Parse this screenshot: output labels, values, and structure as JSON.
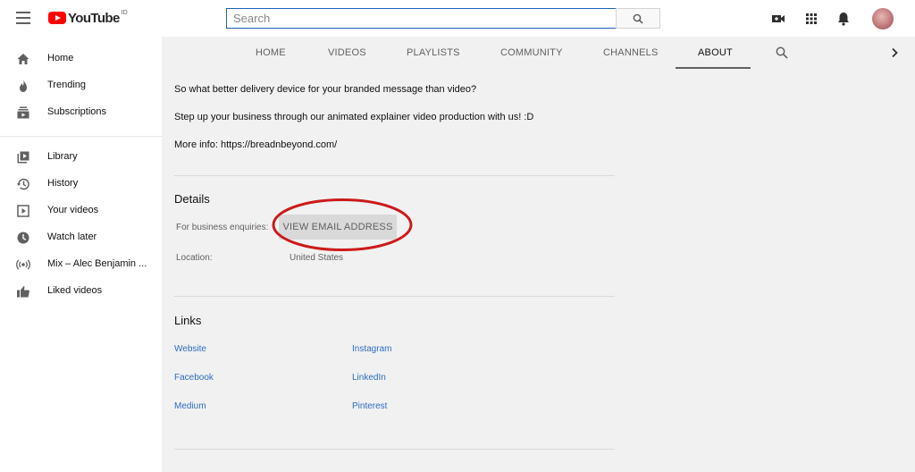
{
  "search": {
    "placeholder": "Search"
  },
  "logo": {
    "text": "YouTube",
    "region": "ID"
  },
  "sidebar": {
    "items": [
      {
        "label": "Home",
        "icon": "home-icon"
      },
      {
        "label": "Trending",
        "icon": "flame-icon"
      },
      {
        "label": "Subscriptions",
        "icon": "subscriptions-icon"
      },
      {
        "label": "Library",
        "icon": "library-icon"
      },
      {
        "label": "History",
        "icon": "history-icon"
      },
      {
        "label": "Your videos",
        "icon": "play-square-icon"
      },
      {
        "label": "Watch later",
        "icon": "clock-icon"
      },
      {
        "label": "Mix – Alec Benjamin ...",
        "icon": "broadcast-icon"
      },
      {
        "label": "Liked videos",
        "icon": "thumbs-up-icon"
      }
    ]
  },
  "tabs": [
    {
      "label": "HOME"
    },
    {
      "label": "VIDEOS"
    },
    {
      "label": "PLAYLISTS"
    },
    {
      "label": "COMMUNITY"
    },
    {
      "label": "CHANNELS"
    },
    {
      "label": "ABOUT",
      "active": true
    }
  ],
  "about": {
    "description": [
      "So what better delivery device for your branded message than video?",
      "Step up your business through our animated explainer video production with us! :D",
      "More info: https://breadnbeyond.com/"
    ],
    "details": {
      "title": "Details",
      "business_label": "For business enquiries:",
      "email_button": "VIEW EMAIL ADDRESS",
      "location_label": "Location:",
      "location_value": "United States"
    },
    "links": {
      "title": "Links",
      "left": [
        "Website",
        "Facebook",
        "Medium"
      ],
      "right": [
        "Instagram",
        "LinkedIn",
        "Pinterest"
      ]
    }
  },
  "colors": {
    "brand": "#ff0000",
    "link": "#2c6bc2",
    "annotation": "#cc1a1a",
    "focus": "#1c62b9"
  }
}
